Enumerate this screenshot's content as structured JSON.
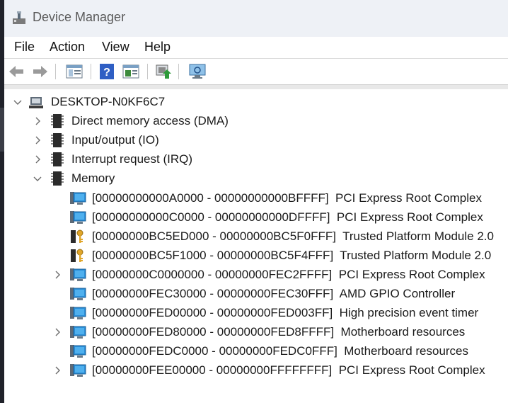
{
  "window": {
    "title": "Device Manager"
  },
  "menu": {
    "file": "File",
    "action": "Action",
    "view": "View",
    "help": "Help"
  },
  "toolbar": {
    "buttons": [
      "back-arrow-icon",
      "forward-arrow-icon",
      "show-hide-tree-icon",
      "help-icon",
      "properties-icon",
      "update-driver-icon",
      "scan-hardware-icon"
    ]
  },
  "tree": {
    "root": "DESKTOP-N0KF6C7",
    "categories": [
      {
        "label": "Direct memory access (DMA)"
      },
      {
        "label": "Input/output (IO)"
      },
      {
        "label": "Interrupt request (IRQ)"
      },
      {
        "label": "Memory"
      }
    ],
    "memory_items": [
      {
        "range": "[00000000000A0000 - 00000000000BFFFF]",
        "device": "PCI Express Root Complex",
        "icon": "monitor",
        "expandable": false
      },
      {
        "range": "[00000000000C0000 - 00000000000DFFFF]",
        "device": "PCI Express Root Complex",
        "icon": "monitor",
        "expandable": false
      },
      {
        "range": "[00000000BC5ED000 - 00000000BC5F0FFF]",
        "device": "Trusted Platform Module 2.0",
        "icon": "key",
        "expandable": false
      },
      {
        "range": "[00000000BC5F1000 - 00000000BC5F4FFF]",
        "device": "Trusted Platform Module 2.0",
        "icon": "key",
        "expandable": false
      },
      {
        "range": "[00000000C0000000 - 00000000FEC2FFFF]",
        "device": "PCI Express Root Complex",
        "icon": "monitor",
        "expandable": true
      },
      {
        "range": "[00000000FEC30000 - 00000000FEC30FFF]",
        "device": "AMD GPIO Controller",
        "icon": "monitor",
        "expandable": false
      },
      {
        "range": "[00000000FED00000 - 00000000FED003FF]",
        "device": "High precision event timer",
        "icon": "monitor",
        "expandable": false
      },
      {
        "range": "[00000000FED80000 - 00000000FED8FFFF]",
        "device": "Motherboard resources",
        "icon": "monitor",
        "expandable": true
      },
      {
        "range": "[00000000FEDC0000 - 00000000FEDC0FFF]",
        "device": "Motherboard resources",
        "icon": "monitor",
        "expandable": false
      },
      {
        "range": "[00000000FEE00000 - 00000000FFFFFFFF]",
        "device": "PCI Express Root Complex",
        "icon": "monitor",
        "expandable": true
      }
    ]
  }
}
